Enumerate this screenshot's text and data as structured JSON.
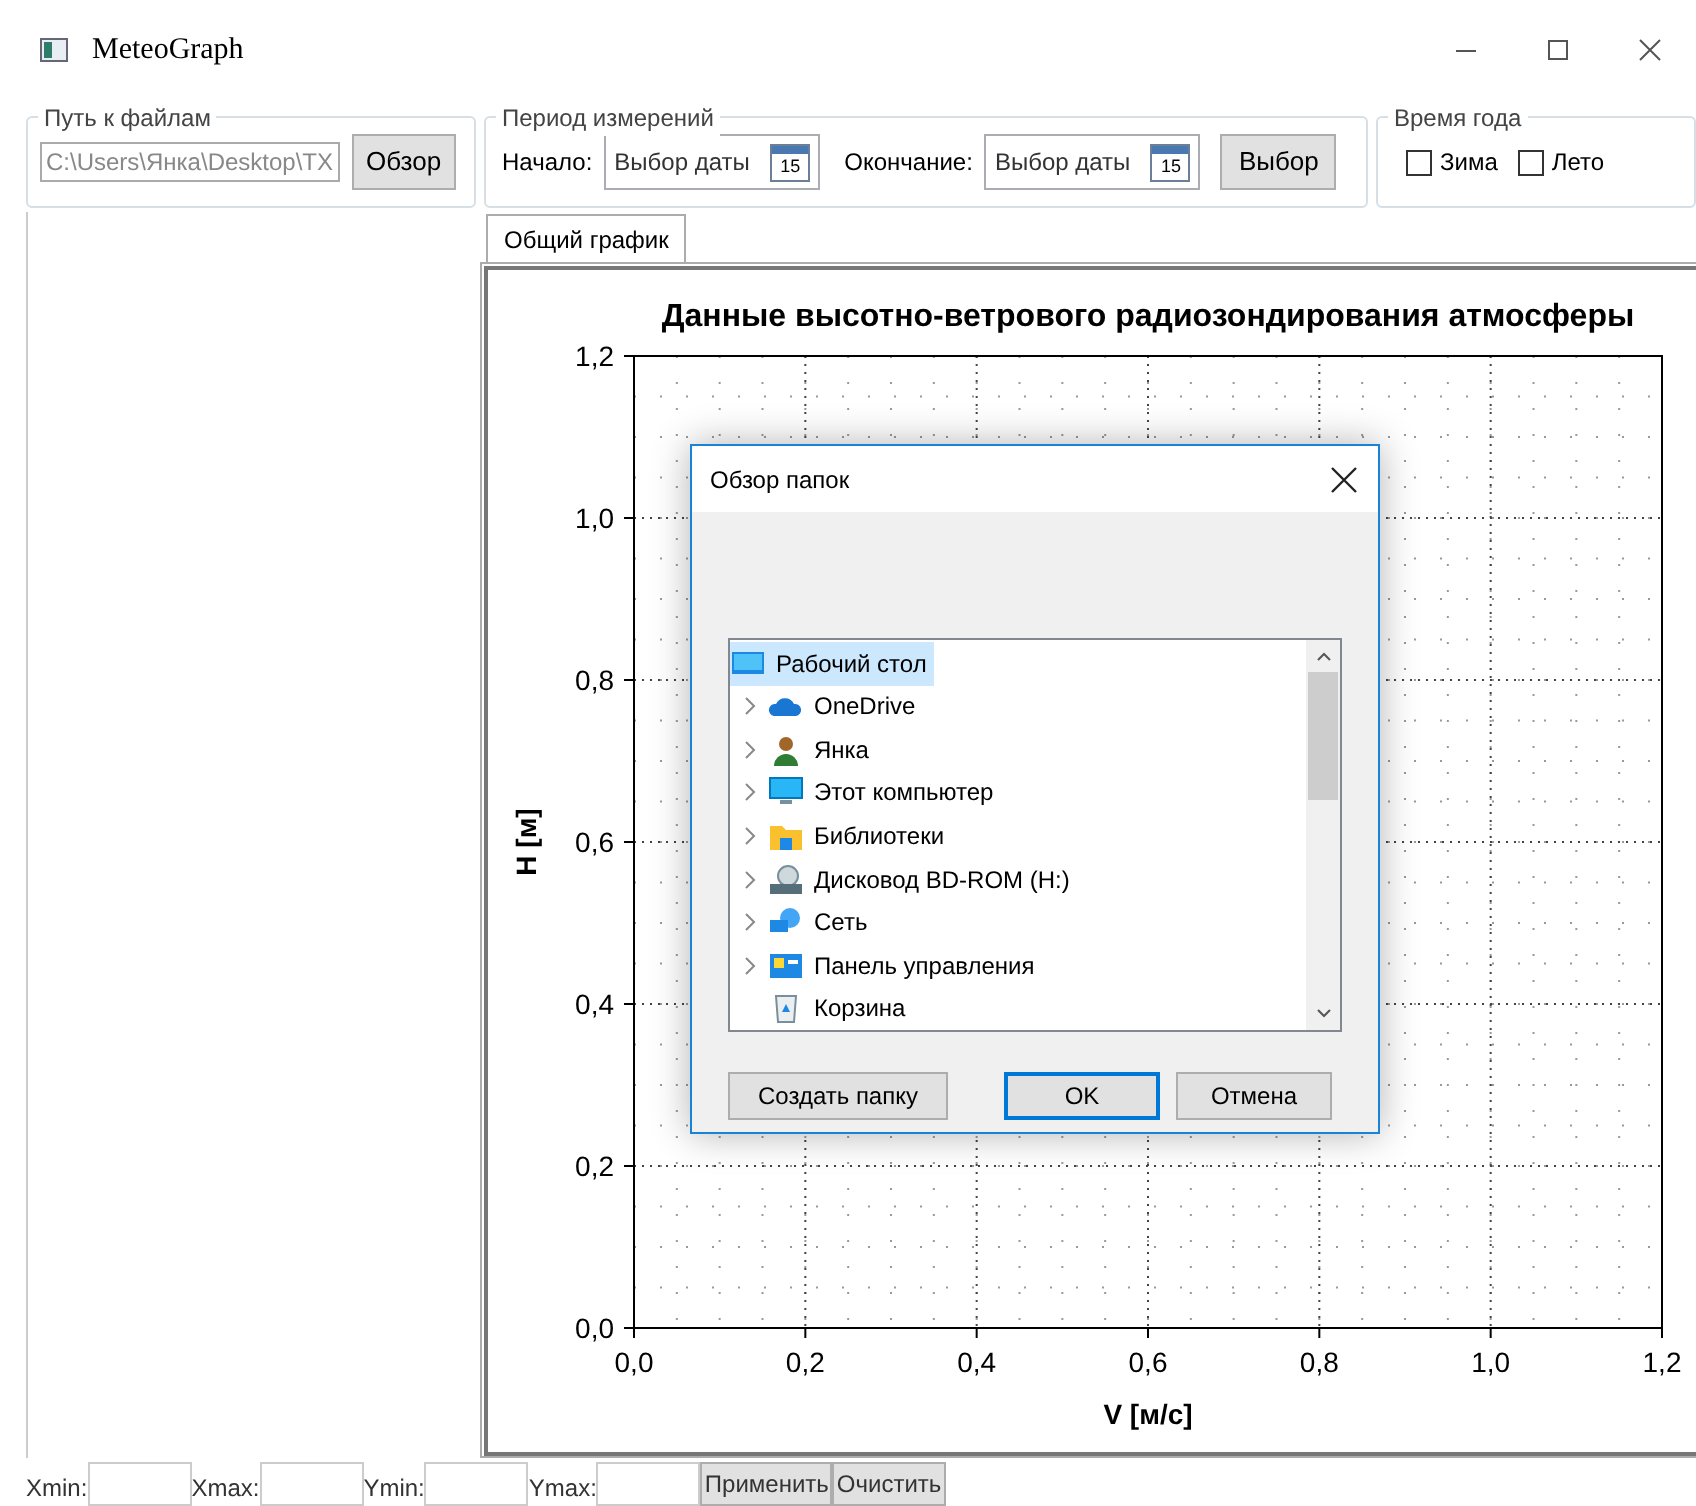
{
  "window": {
    "title": "MeteoGraph"
  },
  "file_group": {
    "legend": "Путь к файлам",
    "path": "C:\\Users\\Янка\\Desktop\\TX",
    "browse_button": "Обзор"
  },
  "period_group": {
    "legend": "Период измерений",
    "start_label": "Начало:",
    "start_placeholder": "Выбор даты",
    "end_label": "Окончание:",
    "end_placeholder": "Выбор даты",
    "start_calendar_day": "15",
    "end_calendar_day": "15",
    "select_button": "Выбор"
  },
  "season_group": {
    "legend": "Время года",
    "options": [
      {
        "label": "Зима",
        "checked": false
      },
      {
        "label": "Лето",
        "checked": false
      }
    ]
  },
  "tabs": [
    {
      "label": "Общий график",
      "selected": true
    }
  ],
  "chart": {
    "chart_data": {
      "type": "line",
      "title": "Данные высотно-ветрового радиозондирования атмосферы",
      "xlabel": "V [м/с]",
      "ylabel": "H [м]",
      "grid": true,
      "xlim": [
        0,
        1.2
      ],
      "ylim": [
        0,
        1.2
      ],
      "xticks": [
        {
          "value": 0,
          "label": "0,0"
        },
        {
          "value": 0.2,
          "label": "0,2"
        },
        {
          "value": 0.4,
          "label": "0,4"
        },
        {
          "value": 0.6,
          "label": "0,6"
        },
        {
          "value": 0.8,
          "label": "0,8"
        },
        {
          "value": 1.0,
          "label": "1,0"
        },
        {
          "value": 1.2,
          "label": "1,2"
        }
      ],
      "yticks": [
        {
          "value": 0,
          "label": "0,0"
        },
        {
          "value": 0.2,
          "label": "0,2"
        },
        {
          "value": 0.4,
          "label": "0,4"
        },
        {
          "value": 0.6,
          "label": "0,6"
        },
        {
          "value": 0.8,
          "label": "0,8"
        },
        {
          "value": 1.0,
          "label": "1,0"
        },
        {
          "value": 1.2,
          "label": "1,2"
        }
      ]
    }
  },
  "bottom_bar": {
    "fields": [
      {
        "label": "Xmin:"
      },
      {
        "label": "Xmax:"
      },
      {
        "label": "Ymin:"
      },
      {
        "label": "Ymax:"
      }
    ],
    "buttons": [
      "Применить",
      "Очистить"
    ]
  },
  "dialog": {
    "title": "Обзор папок",
    "tree": [
      {
        "label": "Рабочий стол",
        "kind": "desktop",
        "expandable": false,
        "selected": true
      },
      {
        "label": "OneDrive",
        "kind": "cloud",
        "expandable": true,
        "selected": false
      },
      {
        "label": "Янка",
        "kind": "user",
        "expandable": true,
        "selected": false
      },
      {
        "label": "Этот компьютер",
        "kind": "computer",
        "expandable": true,
        "selected": false
      },
      {
        "label": "Библиотеки",
        "kind": "folder",
        "expandable": true,
        "selected": false
      },
      {
        "label": "Дисковод BD-ROM (H:)",
        "kind": "drive",
        "expandable": true,
        "selected": false
      },
      {
        "label": "Сеть",
        "kind": "network",
        "expandable": true,
        "selected": false
      },
      {
        "label": "Панель управления",
        "kind": "control",
        "expandable": true,
        "selected": false
      },
      {
        "label": "Корзина",
        "kind": "recycle",
        "expandable": false,
        "selected": false
      }
    ],
    "buttons": [
      {
        "label": "Создать папку",
        "kind": "normal"
      },
      {
        "label": "OK",
        "kind": "default"
      },
      {
        "label": "Отмена",
        "kind": "normal"
      }
    ]
  }
}
